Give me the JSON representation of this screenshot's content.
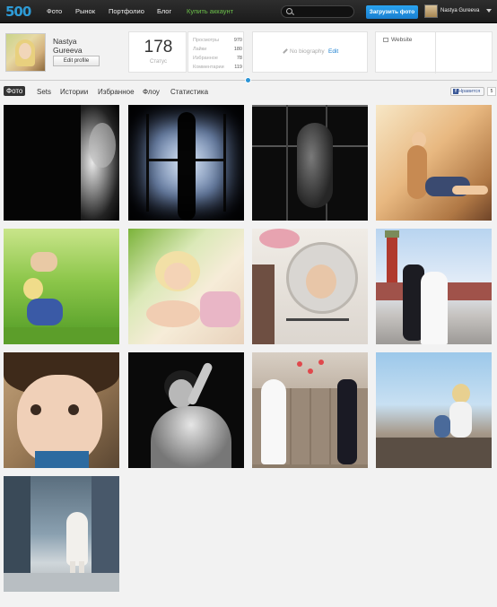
{
  "nav": {
    "logo": "500",
    "links": [
      "Фото",
      "Рынок",
      "Портфолио",
      "Блог"
    ],
    "promo_link": "Купить аккаунт",
    "upload_label": "Загрузить фото",
    "user_name": "Nastya Gureeva"
  },
  "profile": {
    "name": "Nastya Gureeva",
    "edit_label": "Edit profile",
    "status_value": "178",
    "status_label": "Статус",
    "stats": [
      {
        "label": "Просмотры",
        "value": "970"
      },
      {
        "label": "Лайки",
        "value": "180"
      },
      {
        "label": "Избранное",
        "value": "78"
      },
      {
        "label": "Комментарии",
        "value": "119"
      }
    ],
    "bio_placeholder": "No biography",
    "bio_edit": "Edit",
    "website_label": "Website"
  },
  "tabs": [
    "Фото",
    "Sets",
    "Истории",
    "Избранное",
    "Флоу",
    "Статистика"
  ],
  "facebook": {
    "like_label": "Нравится",
    "like_count": "5"
  },
  "colors": {
    "accent": "#2a94d6",
    "promo": "#6cc04a",
    "topbar": "#1b1b1b"
  },
  "photos": [
    "bw-figure-dark",
    "silhouette-window",
    "nude-back-window",
    "woman-lounging-warm",
    "mother-lifting-child",
    "mother-baby-bed",
    "woman-mirror-flowers",
    "wedding-red-square",
    "child-portrait",
    "bw-woman-arm-raised",
    "wedding-couple-hearts",
    "mother-child-rocks",
    "child-winter-coat"
  ]
}
